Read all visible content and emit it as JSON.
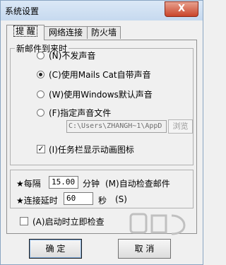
{
  "window": {
    "title": "系统设置",
    "close_glyph": "X"
  },
  "tabs": [
    {
      "label": "提 醒"
    },
    {
      "label": "网络连接"
    },
    {
      "label": "防火墙"
    }
  ],
  "new_mail": {
    "group_label": "新邮件到来时",
    "options": [
      {
        "label": "(N)不发声音",
        "selected": false
      },
      {
        "label": "(C)使用Mails Cat自带声音",
        "selected": true
      },
      {
        "label": "(W)使用Windows默认声音",
        "selected": false
      },
      {
        "label": "(F)指定声音文件",
        "selected": false
      }
    ],
    "sound_file_path": "C:\\Users\\ZHANGH~1\\AppD",
    "browse_label": "浏览",
    "tray_anim": {
      "label": "(I)任务栏显示动画图标",
      "checked": true
    }
  },
  "check": {
    "interval_prefix": "★每隔",
    "interval_value": "15.00",
    "interval_suffix": "分钟",
    "interval_shortcut": "(M)自动检查邮件",
    "delay_prefix": "★连接延时",
    "delay_value": "60",
    "delay_suffix": "秒",
    "delay_shortcut": "(S)"
  },
  "startup_check": {
    "label": "(A)启动时立即检查",
    "checked": false
  },
  "buttons": {
    "ok": "确 定",
    "cancel": "取 消"
  },
  "colors": {
    "close": "#c9452b",
    "titlebar": "#dbe8f6",
    "watermark": "#b8b8b8"
  }
}
